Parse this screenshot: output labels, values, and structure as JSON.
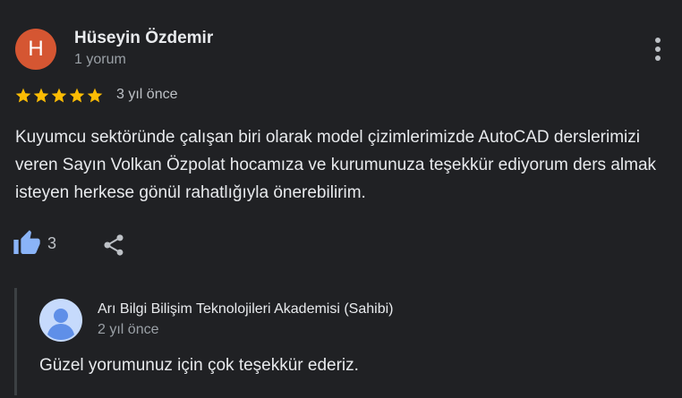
{
  "review": {
    "author": {
      "initial": "H",
      "name": "Hüseyin Özdemir",
      "meta": "1 yorum",
      "avatar_color": "#d55632"
    },
    "more_icon": "more-vert-icon",
    "rating": 5,
    "rating_max": 5,
    "star_color": "#fbbc04",
    "date": "3 yıl önce",
    "text": "Kuyumcu sektöründe çalışan biri olarak model çizimlerimizde AutoCAD derslerimizi veren Sayın Volkan Özpolat hocamıza ve kurumunuza teşekkür ediyorum ders almak isteyen herkese gönül rahatlığıyla önerebilirim.",
    "likes": {
      "icon": "thumbs-up-icon",
      "count": "3",
      "color": "#8ab4f8"
    },
    "share_icon": "share-icon"
  },
  "owner_reply": {
    "avatar_icon": "default-profile-icon",
    "name": "Arı Bilgi Bilişim Teknolojileri Akademisi (Sahibi)",
    "date": "2 yıl önce",
    "text": "Güzel yorumunuz için çok teşekkür ederiz."
  }
}
